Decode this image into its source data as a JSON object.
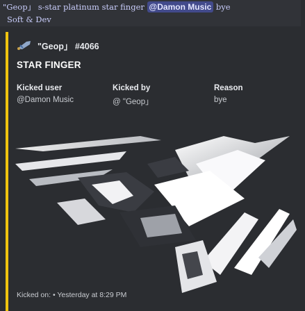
{
  "message": {
    "prefix": "\"Geop」 s-star platinum star finger",
    "mention": "@Damon Music",
    "suffix": "bye",
    "subline": "Soft & Dev"
  },
  "embed": {
    "accent_color": "#f1c40f",
    "author_icon": "sword-icon",
    "author": "\"Geop」 #4066",
    "title": "STAR FINGER",
    "fields": [
      {
        "name": "Kicked user",
        "value": "@Damon Music"
      },
      {
        "name": "Kicked by",
        "value": "@ \"Geop」"
      },
      {
        "name": "Reason",
        "value": "bye"
      }
    ],
    "footer": "Kicked on: • Yesterday at 8:29 PM"
  }
}
